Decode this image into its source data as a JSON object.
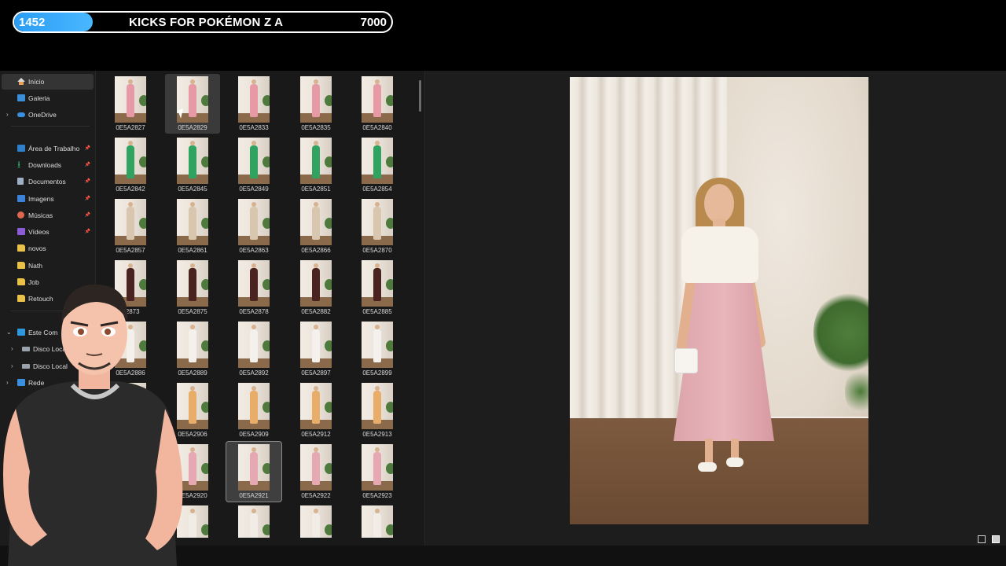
{
  "overlay": {
    "current": "1452",
    "title": "KICKS FOR POKÉMON Z A",
    "goal": "7000",
    "progress": 0.2074,
    "fill_color": "#2a9df4"
  },
  "nav": {
    "items": [
      {
        "label": "Início",
        "icon": "home-icon",
        "selected": true
      },
      {
        "label": "Galeria",
        "icon": "gallery-icon"
      },
      {
        "label": "OneDrive",
        "icon": "cloud-icon",
        "expandable": true
      },
      {
        "label": "Área de Trabalho",
        "icon": "desktop-icon",
        "pinned": true
      },
      {
        "label": "Downloads",
        "icon": "download-icon",
        "pinned": true
      },
      {
        "label": "Documentos",
        "icon": "document-icon",
        "pinned": true
      },
      {
        "label": "Imagens",
        "icon": "images-icon",
        "pinned": true
      },
      {
        "label": "Músicas",
        "icon": "music-icon",
        "pinned": true
      },
      {
        "label": "Vídeos",
        "icon": "video-icon",
        "pinned": true
      },
      {
        "label": "novos",
        "icon": "folder-icon"
      },
      {
        "label": "Nath",
        "icon": "folder-icon"
      },
      {
        "label": "Job",
        "icon": "folder-icon"
      },
      {
        "label": "Retouch",
        "icon": "folder-icon"
      },
      {
        "label": "Este Com",
        "icon": "computer-icon",
        "expanded": true
      },
      {
        "label": "Disco Local",
        "icon": "disk-icon",
        "expandable": true
      },
      {
        "label": "Disco Local",
        "icon": "disk-icon",
        "expandable": true
      },
      {
        "label": "Rede",
        "icon": "network-icon",
        "expandable": true
      }
    ]
  },
  "files": [
    [
      "0E5A2827",
      "0E5A2829",
      "0E5A2833",
      "0E5A2835",
      "0E5A2840"
    ],
    [
      "0E5A2842",
      "0E5A2845",
      "0E5A2849",
      "0E5A2851",
      "0E5A2854"
    ],
    [
      "0E5A2857",
      "0E5A2861",
      "0E5A2863",
      "0E5A2866",
      "0E5A2870"
    ],
    [
      "A2873",
      "0E5A2875",
      "0E5A2878",
      "0E5A2882",
      "0E5A2885"
    ],
    [
      "0E5A2886",
      "0E5A2889",
      "0E5A2892",
      "0E5A2897",
      "0E5A2899"
    ],
    [
      "",
      "0E5A2906",
      "0E5A2909",
      "0E5A2912",
      "0E5A2913"
    ],
    [
      "18",
      "0E5A2920",
      "0E5A2921",
      "0E5A2922",
      "0E5A2923"
    ],
    [
      "",
      "",
      "",
      "",
      ""
    ]
  ],
  "outfit_colors": [
    "#e79aa6",
    "#2fa35f",
    "#d9c6ae",
    "#4a2320",
    "#f4f1ec",
    "#e9ad6a",
    "#e6a9b3",
    "#f1ece6"
  ],
  "hovered_file": "0E5A2829",
  "selected_file": "0E5A2921",
  "view_icons": [
    "details-view-icon",
    "preview-pane-icon"
  ]
}
